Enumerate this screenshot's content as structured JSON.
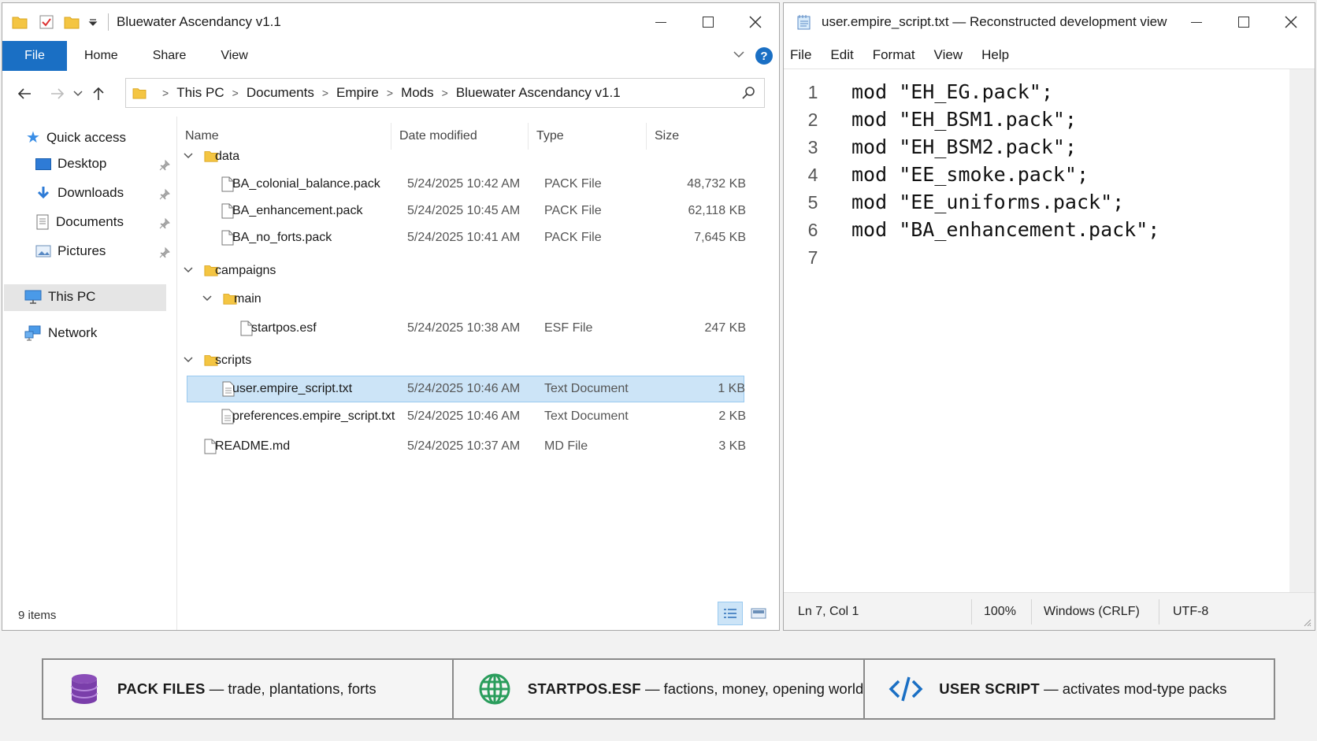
{
  "explorer": {
    "title": "Bluewater Ascendancy v1.1",
    "ribbon_tabs": [
      "File",
      "Home",
      "Share",
      "View"
    ],
    "breadcrumb": [
      "This PC",
      "Documents",
      "Empire",
      "Mods",
      "Bluewater Ascendancy v1.1"
    ],
    "nav": {
      "quick_access": "Quick access",
      "desktop": "Desktop",
      "downloads": "Downloads",
      "documents": "Documents",
      "pictures": "Pictures",
      "this_pc": "This PC",
      "network": "Network"
    },
    "columns": {
      "name": "Name",
      "date": "Date modified",
      "type": "Type",
      "size": "Size"
    },
    "rows": [
      {
        "name": "data",
        "kind": "folder"
      },
      {
        "name": "BA_colonial_balance.pack",
        "date": "5/24/2025 10:42 AM",
        "type": "PACK File",
        "size": "48,732 KB"
      },
      {
        "name": "BA_enhancement.pack",
        "date": "5/24/2025 10:45 AM",
        "type": "PACK File",
        "size": "62,118 KB"
      },
      {
        "name": "BA_no_forts.pack",
        "date": "5/24/2025 10:41 AM",
        "type": "PACK File",
        "size": "7,645 KB"
      },
      {
        "name": "campaigns",
        "kind": "folder"
      },
      {
        "name": "main",
        "kind": "folder"
      },
      {
        "name": "startpos.esf",
        "date": "5/24/2025 10:38 AM",
        "type": "ESF File",
        "size": "247 KB"
      },
      {
        "name": "scripts",
        "kind": "folder"
      },
      {
        "name": "user.empire_script.txt",
        "date": "5/24/2025 10:46 AM",
        "type": "Text Document",
        "size": "1 KB"
      },
      {
        "name": "preferences.empire_script.txt",
        "date": "5/24/2025 10:46 AM",
        "type": "Text Document",
        "size": "2 KB"
      },
      {
        "name": "README.md",
        "date": "5/24/2025 10:37 AM",
        "type": "MD File",
        "size": "3 KB"
      }
    ],
    "item_count": "9 items",
    "colors": {
      "accent": "#1a6fc4",
      "selection": "#cce4f7",
      "folder": "#f4c542"
    }
  },
  "notepad": {
    "title": "user.empire_script.txt — Reconstructed development view",
    "menu": [
      "File",
      "Edit",
      "Format",
      "View",
      "Help"
    ],
    "line_numbers": [
      "1",
      "2",
      "3",
      "4",
      "5",
      "6",
      "7"
    ],
    "lines": [
      "mod \"EH_EG.pack\";",
      "mod \"EH_BSM1.pack\";",
      "mod \"EH_BSM2.pack\";",
      "mod \"EE_smoke.pack\";",
      "mod \"EE_uniforms.pack\";",
      "mod \"BA_enhancement.pack\";",
      ""
    ],
    "status": {
      "position": "Ln 7, Col 1",
      "zoom": "100%",
      "line_ending": "Windows (CRLF)",
      "encoding": "UTF-8"
    }
  },
  "legend": [
    {
      "icon": "database-icon",
      "label": "PACK FILES",
      "desc": " — trade, plantations, forts"
    },
    {
      "icon": "globe-icon",
      "label": "STARTPOS.ESF",
      "desc": " — factions, money, opening world"
    },
    {
      "icon": "code-icon",
      "label": "USER SCRIPT",
      "desc": " — activates mod-type packs"
    }
  ]
}
